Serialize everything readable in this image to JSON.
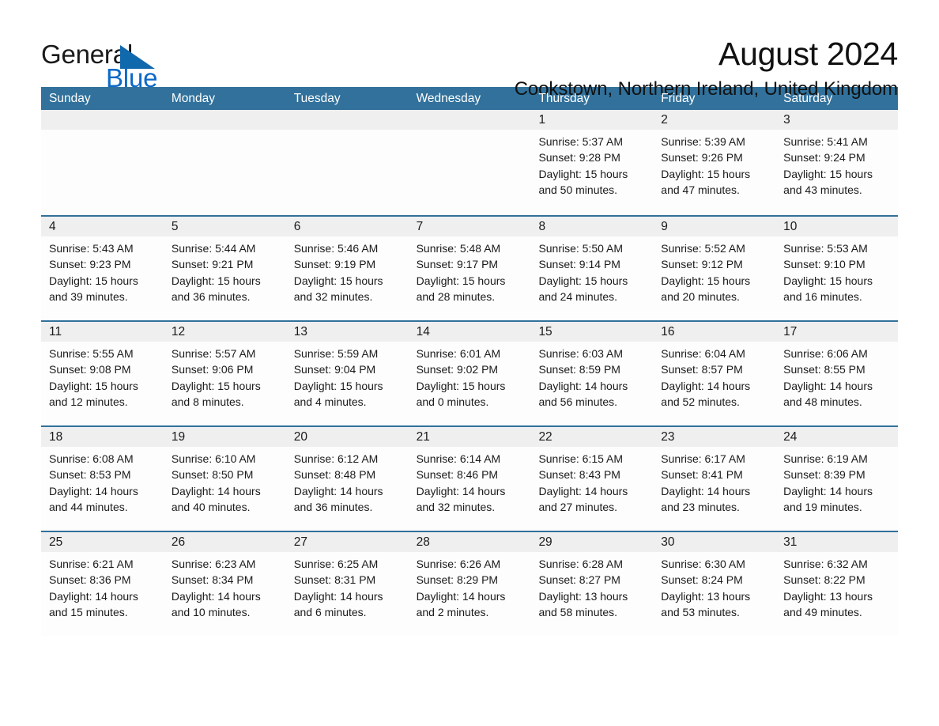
{
  "brand": {
    "name_part1": "General",
    "name_part2": "Blue",
    "triangle_color": "#1068ad"
  },
  "header": {
    "month_title": "August 2024",
    "location": "Cookstown, Northern Ireland, United Kingdom"
  },
  "theme": {
    "header_blue": "#31719b",
    "day_band_gray": "#efefef",
    "text_color": "#1a1a1a"
  },
  "weekdays": [
    "Sunday",
    "Monday",
    "Tuesday",
    "Wednesday",
    "Thursday",
    "Friday",
    "Saturday"
  ],
  "weeks": [
    [
      {
        "day": "",
        "sunrise": "",
        "sunset": "",
        "daylight": ""
      },
      {
        "day": "",
        "sunrise": "",
        "sunset": "",
        "daylight": ""
      },
      {
        "day": "",
        "sunrise": "",
        "sunset": "",
        "daylight": ""
      },
      {
        "day": "",
        "sunrise": "",
        "sunset": "",
        "daylight": ""
      },
      {
        "day": "1",
        "sunrise": "Sunrise: 5:37 AM",
        "sunset": "Sunset: 9:28 PM",
        "daylight": "Daylight: 15 hours and 50 minutes."
      },
      {
        "day": "2",
        "sunrise": "Sunrise: 5:39 AM",
        "sunset": "Sunset: 9:26 PM",
        "daylight": "Daylight: 15 hours and 47 minutes."
      },
      {
        "day": "3",
        "sunrise": "Sunrise: 5:41 AM",
        "sunset": "Sunset: 9:24 PM",
        "daylight": "Daylight: 15 hours and 43 minutes."
      }
    ],
    [
      {
        "day": "4",
        "sunrise": "Sunrise: 5:43 AM",
        "sunset": "Sunset: 9:23 PM",
        "daylight": "Daylight: 15 hours and 39 minutes."
      },
      {
        "day": "5",
        "sunrise": "Sunrise: 5:44 AM",
        "sunset": "Sunset: 9:21 PM",
        "daylight": "Daylight: 15 hours and 36 minutes."
      },
      {
        "day": "6",
        "sunrise": "Sunrise: 5:46 AM",
        "sunset": "Sunset: 9:19 PM",
        "daylight": "Daylight: 15 hours and 32 minutes."
      },
      {
        "day": "7",
        "sunrise": "Sunrise: 5:48 AM",
        "sunset": "Sunset: 9:17 PM",
        "daylight": "Daylight: 15 hours and 28 minutes."
      },
      {
        "day": "8",
        "sunrise": "Sunrise: 5:50 AM",
        "sunset": "Sunset: 9:14 PM",
        "daylight": "Daylight: 15 hours and 24 minutes."
      },
      {
        "day": "9",
        "sunrise": "Sunrise: 5:52 AM",
        "sunset": "Sunset: 9:12 PM",
        "daylight": "Daylight: 15 hours and 20 minutes."
      },
      {
        "day": "10",
        "sunrise": "Sunrise: 5:53 AM",
        "sunset": "Sunset: 9:10 PM",
        "daylight": "Daylight: 15 hours and 16 minutes."
      }
    ],
    [
      {
        "day": "11",
        "sunrise": "Sunrise: 5:55 AM",
        "sunset": "Sunset: 9:08 PM",
        "daylight": "Daylight: 15 hours and 12 minutes."
      },
      {
        "day": "12",
        "sunrise": "Sunrise: 5:57 AM",
        "sunset": "Sunset: 9:06 PM",
        "daylight": "Daylight: 15 hours and 8 minutes."
      },
      {
        "day": "13",
        "sunrise": "Sunrise: 5:59 AM",
        "sunset": "Sunset: 9:04 PM",
        "daylight": "Daylight: 15 hours and 4 minutes."
      },
      {
        "day": "14",
        "sunrise": "Sunrise: 6:01 AM",
        "sunset": "Sunset: 9:02 PM",
        "daylight": "Daylight: 15 hours and 0 minutes."
      },
      {
        "day": "15",
        "sunrise": "Sunrise: 6:03 AM",
        "sunset": "Sunset: 8:59 PM",
        "daylight": "Daylight: 14 hours and 56 minutes."
      },
      {
        "day": "16",
        "sunrise": "Sunrise: 6:04 AM",
        "sunset": "Sunset: 8:57 PM",
        "daylight": "Daylight: 14 hours and 52 minutes."
      },
      {
        "day": "17",
        "sunrise": "Sunrise: 6:06 AM",
        "sunset": "Sunset: 8:55 PM",
        "daylight": "Daylight: 14 hours and 48 minutes."
      }
    ],
    [
      {
        "day": "18",
        "sunrise": "Sunrise: 6:08 AM",
        "sunset": "Sunset: 8:53 PM",
        "daylight": "Daylight: 14 hours and 44 minutes."
      },
      {
        "day": "19",
        "sunrise": "Sunrise: 6:10 AM",
        "sunset": "Sunset: 8:50 PM",
        "daylight": "Daylight: 14 hours and 40 minutes."
      },
      {
        "day": "20",
        "sunrise": "Sunrise: 6:12 AM",
        "sunset": "Sunset: 8:48 PM",
        "daylight": "Daylight: 14 hours and 36 minutes."
      },
      {
        "day": "21",
        "sunrise": "Sunrise: 6:14 AM",
        "sunset": "Sunset: 8:46 PM",
        "daylight": "Daylight: 14 hours and 32 minutes."
      },
      {
        "day": "22",
        "sunrise": "Sunrise: 6:15 AM",
        "sunset": "Sunset: 8:43 PM",
        "daylight": "Daylight: 14 hours and 27 minutes."
      },
      {
        "day": "23",
        "sunrise": "Sunrise: 6:17 AM",
        "sunset": "Sunset: 8:41 PM",
        "daylight": "Daylight: 14 hours and 23 minutes."
      },
      {
        "day": "24",
        "sunrise": "Sunrise: 6:19 AM",
        "sunset": "Sunset: 8:39 PM",
        "daylight": "Daylight: 14 hours and 19 minutes."
      }
    ],
    [
      {
        "day": "25",
        "sunrise": "Sunrise: 6:21 AM",
        "sunset": "Sunset: 8:36 PM",
        "daylight": "Daylight: 14 hours and 15 minutes."
      },
      {
        "day": "26",
        "sunrise": "Sunrise: 6:23 AM",
        "sunset": "Sunset: 8:34 PM",
        "daylight": "Daylight: 14 hours and 10 minutes."
      },
      {
        "day": "27",
        "sunrise": "Sunrise: 6:25 AM",
        "sunset": "Sunset: 8:31 PM",
        "daylight": "Daylight: 14 hours and 6 minutes."
      },
      {
        "day": "28",
        "sunrise": "Sunrise: 6:26 AM",
        "sunset": "Sunset: 8:29 PM",
        "daylight": "Daylight: 14 hours and 2 minutes."
      },
      {
        "day": "29",
        "sunrise": "Sunrise: 6:28 AM",
        "sunset": "Sunset: 8:27 PM",
        "daylight": "Daylight: 13 hours and 58 minutes."
      },
      {
        "day": "30",
        "sunrise": "Sunrise: 6:30 AM",
        "sunset": "Sunset: 8:24 PM",
        "daylight": "Daylight: 13 hours and 53 minutes."
      },
      {
        "day": "31",
        "sunrise": "Sunrise: 6:32 AM",
        "sunset": "Sunset: 8:22 PM",
        "daylight": "Daylight: 13 hours and 49 minutes."
      }
    ]
  ]
}
